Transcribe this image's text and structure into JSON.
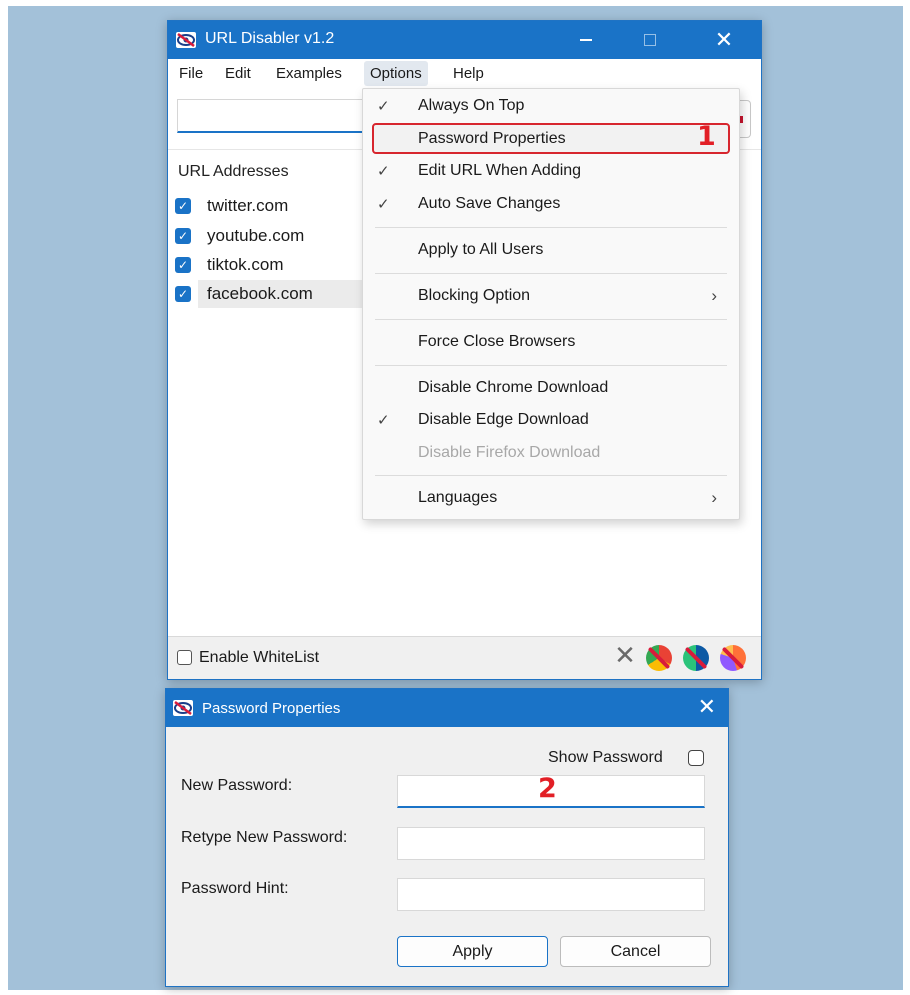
{
  "main_window": {
    "title": "URL Disabler v1.2",
    "menu": [
      "File",
      "Edit",
      "Examples",
      "Options",
      "Help"
    ],
    "list_header": "URL Addresses",
    "urls": [
      {
        "label": "twitter.com",
        "checked": true
      },
      {
        "label": "youtube.com",
        "checked": true
      },
      {
        "label": "tiktok.com",
        "checked": true
      },
      {
        "label": "facebook.com",
        "checked": true
      }
    ],
    "whitelist_label": "Enable WhiteList",
    "status_icons": [
      "close-icon",
      "chrome-blocked-icon",
      "edge-blocked-icon",
      "firefox-blocked-icon"
    ]
  },
  "options_menu": {
    "items": [
      {
        "label": "Always On Top",
        "checked": true
      },
      {
        "label": "Password Properties",
        "checked": false,
        "highlighted": true
      },
      {
        "label": "Edit URL When Adding",
        "checked": true
      },
      {
        "label": "Auto Save Changes",
        "checked": true
      },
      {
        "label": "Apply to All Users",
        "checked": false
      },
      {
        "label": "Blocking Option",
        "submenu": true
      },
      {
        "label": "Force Close Browsers",
        "checked": false
      },
      {
        "label": "Disable Chrome Download",
        "checked": false
      },
      {
        "label": "Disable Edge Download",
        "checked": true
      },
      {
        "label": "Disable Firefox Download",
        "disabled": true
      },
      {
        "label": "Languages",
        "submenu": true
      }
    ],
    "check_glyph": "✓",
    "submenu_glyph": "›"
  },
  "annotations": {
    "step1": "1",
    "step2": "2"
  },
  "password_dialog": {
    "title": "Password Properties",
    "show_password_label": "Show Password",
    "new_password_label": "New Password:",
    "retype_label": "Retype New Password:",
    "hint_label": "Password Hint:",
    "apply_label": "Apply",
    "cancel_label": "Cancel"
  },
  "colors": {
    "accent": "#1a73c7",
    "callout": "#e21f26",
    "backdrop": "#a3c1d9"
  }
}
